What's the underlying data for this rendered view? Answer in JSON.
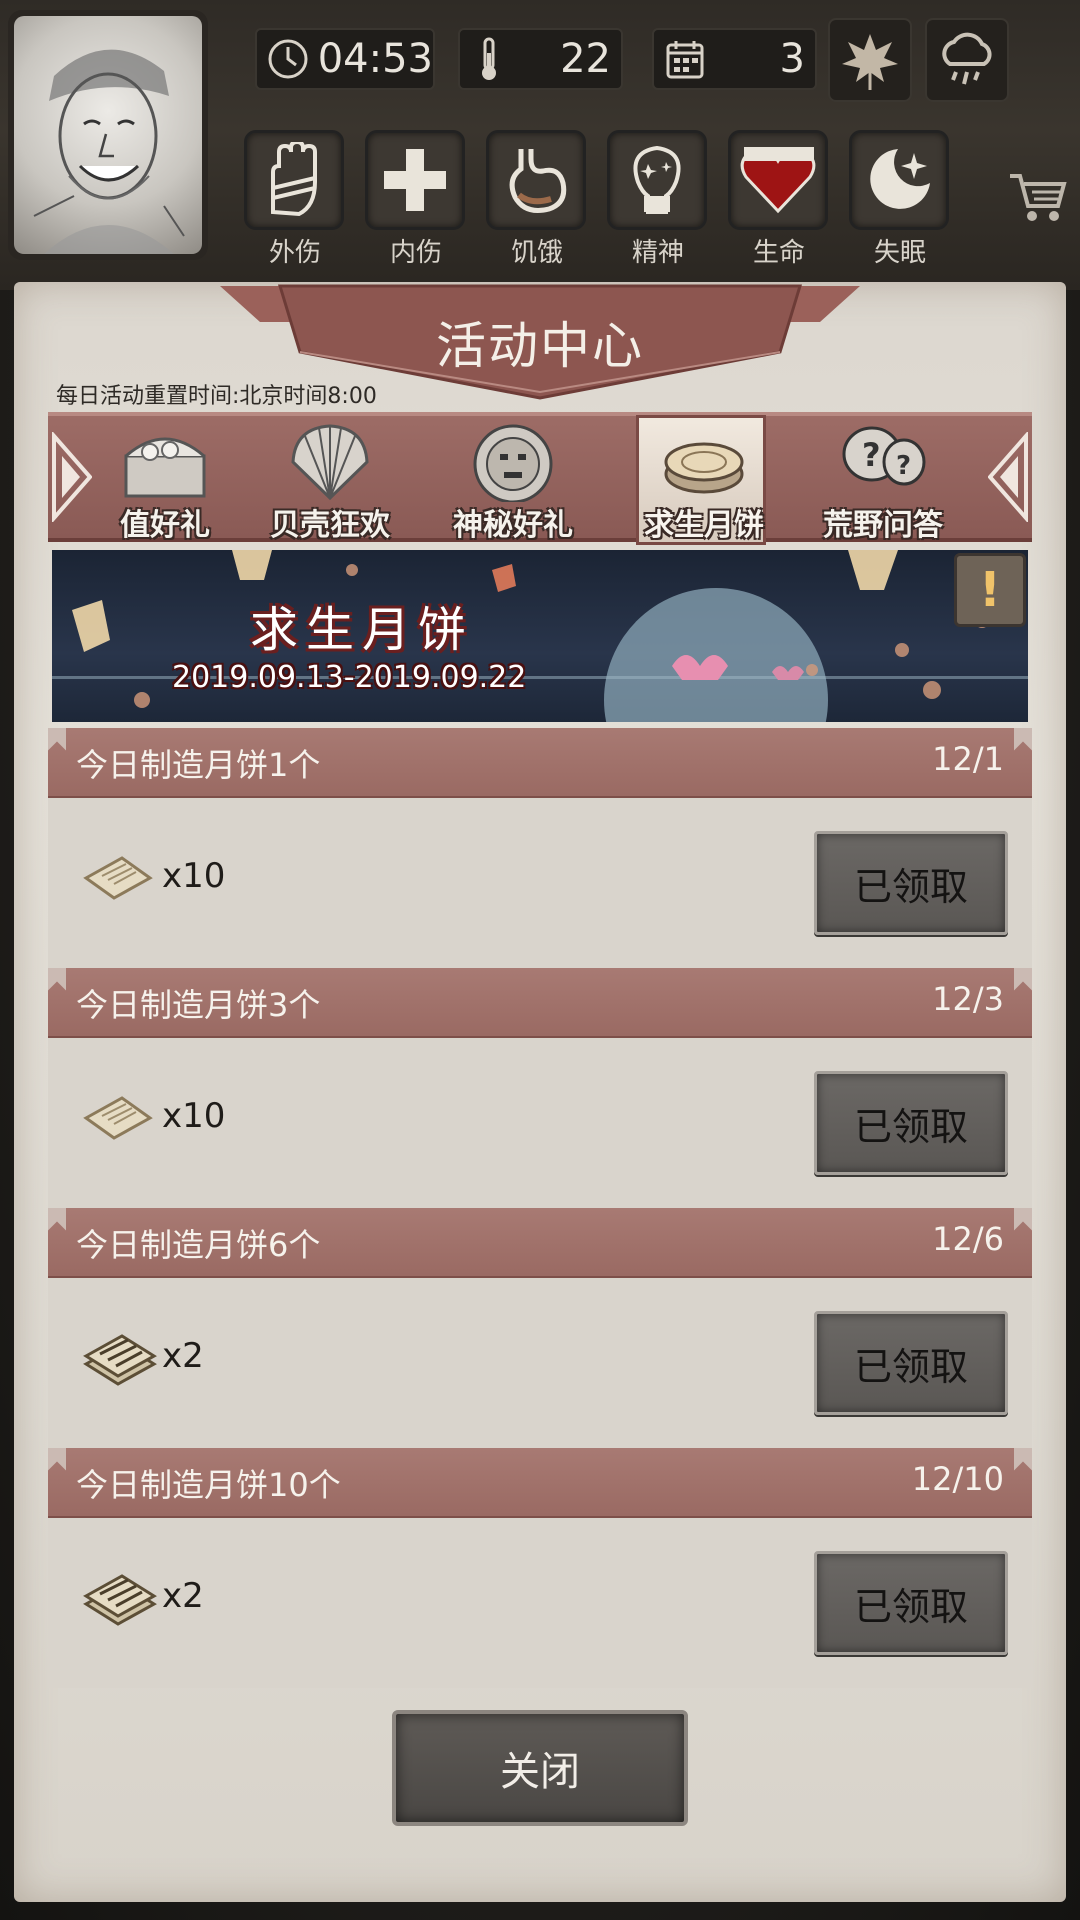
{
  "hud": {
    "time": "04:53",
    "temperature": "22",
    "day": "3",
    "statuses": [
      {
        "label": "外伤",
        "icon": "hand-bandage-icon"
      },
      {
        "label": "内伤",
        "icon": "cross-icon"
      },
      {
        "label": "饥饿",
        "icon": "stomach-icon"
      },
      {
        "label": "精神",
        "icon": "mind-icon"
      },
      {
        "label": "生命",
        "icon": "heart-icon"
      },
      {
        "label": "失眠",
        "icon": "moon-star-icon"
      }
    ],
    "weather": [
      "leaf-icon",
      "rain-cloud-icon"
    ]
  },
  "panel": {
    "title": "活动中心",
    "reset_note": "每日活动重置时间:北京时间8:00",
    "tabs": [
      {
        "label": "值好礼",
        "icon": "treasure-chest-icon",
        "active": false
      },
      {
        "label": "贝壳狂欢",
        "icon": "seashell-icon",
        "active": false
      },
      {
        "label": "神秘好礼",
        "icon": "tribal-mask-icon",
        "active": false
      },
      {
        "label": "求生月饼",
        "icon": "mooncake-icon",
        "active": true
      },
      {
        "label": "荒野问答",
        "icon": "question-bubbles-icon",
        "active": false
      }
    ],
    "event": {
      "title": "求生月饼",
      "dates": "2019.09.13-2019.09.22",
      "info_label": "!"
    },
    "tasks": [
      {
        "label": "今日制造月饼1个",
        "progress": "12/1",
        "reward_icon": "paper-note-icon",
        "qty": "x10",
        "button": "已领取"
      },
      {
        "label": "今日制造月饼3个",
        "progress": "12/3",
        "reward_icon": "paper-note-icon",
        "qty": "x10",
        "button": "已领取"
      },
      {
        "label": "今日制造月饼6个",
        "progress": "12/6",
        "reward_icon": "paper-bundle-icon",
        "qty": "x2",
        "button": "已领取"
      },
      {
        "label": "今日制造月饼10个",
        "progress": "12/10",
        "reward_icon": "paper-bundle-icon",
        "qty": "x2",
        "button": "已领取"
      }
    ],
    "close_label": "关闭"
  },
  "colors": {
    "banner_red": "#8a5a55",
    "parchment": "#e0dbd3",
    "button_gray": "#5a5754"
  }
}
